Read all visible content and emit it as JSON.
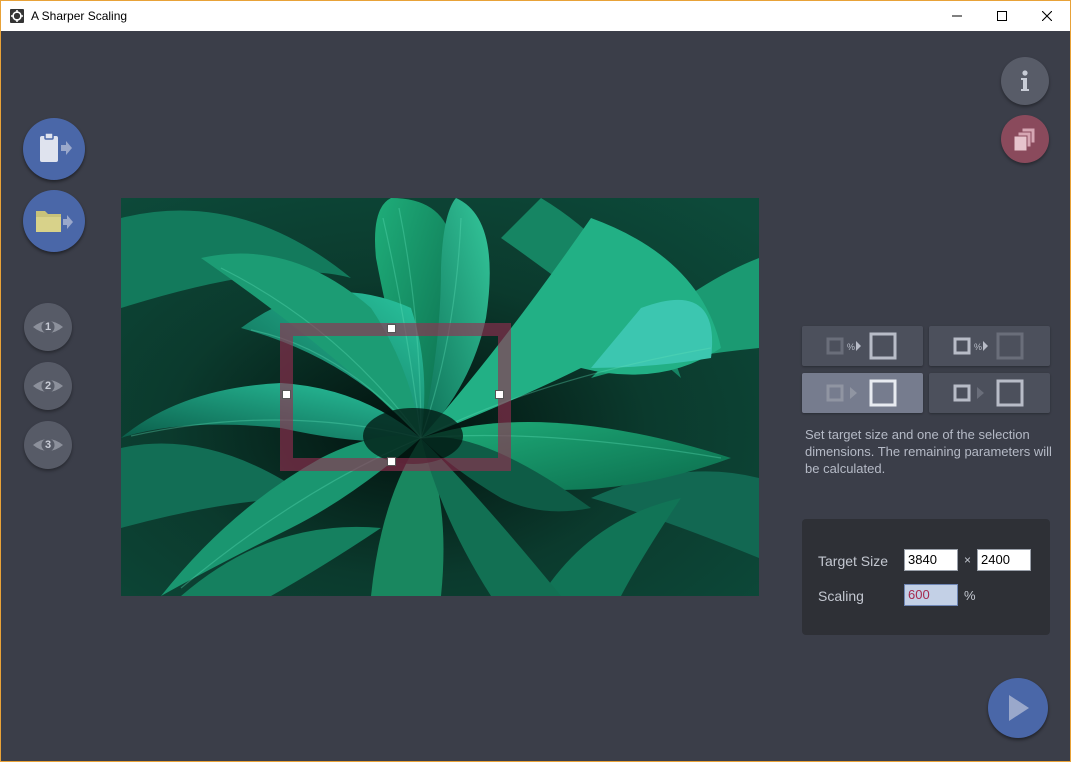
{
  "window": {
    "title": "A Sharper Scaling"
  },
  "toolbar": {
    "paste_icon": "clipboard-paste-icon",
    "open_icon": "folder-open-icon",
    "preview_buttons": [
      "1",
      "2",
      "3"
    ],
    "info_icon": "info-icon",
    "batch_icon": "stacked-layers-icon",
    "run_icon": "play-icon"
  },
  "modes": {
    "items": [
      {
        "icon": "source-percent-to-target-icon",
        "active": false
      },
      {
        "icon": "source-percent-to-target-alt-icon",
        "active": false
      },
      {
        "icon": "source-to-target-size-icon",
        "active": true
      },
      {
        "icon": "source-to-target-box-icon",
        "active": false
      }
    ],
    "description": "Set target size and one of the selection dimensions. The remaining parameters will be calculated."
  },
  "settings": {
    "target_size_label": "Target Size",
    "target_width": "3840",
    "times_sign": "×",
    "target_height": "2400",
    "scaling_label": "Scaling",
    "scaling_value": "600",
    "scaling_unit": "%"
  },
  "colors": {
    "background": "#3b3e49",
    "accent_blue": "#4a67a8",
    "selection": "#962d50",
    "panel": "#2e3036"
  }
}
